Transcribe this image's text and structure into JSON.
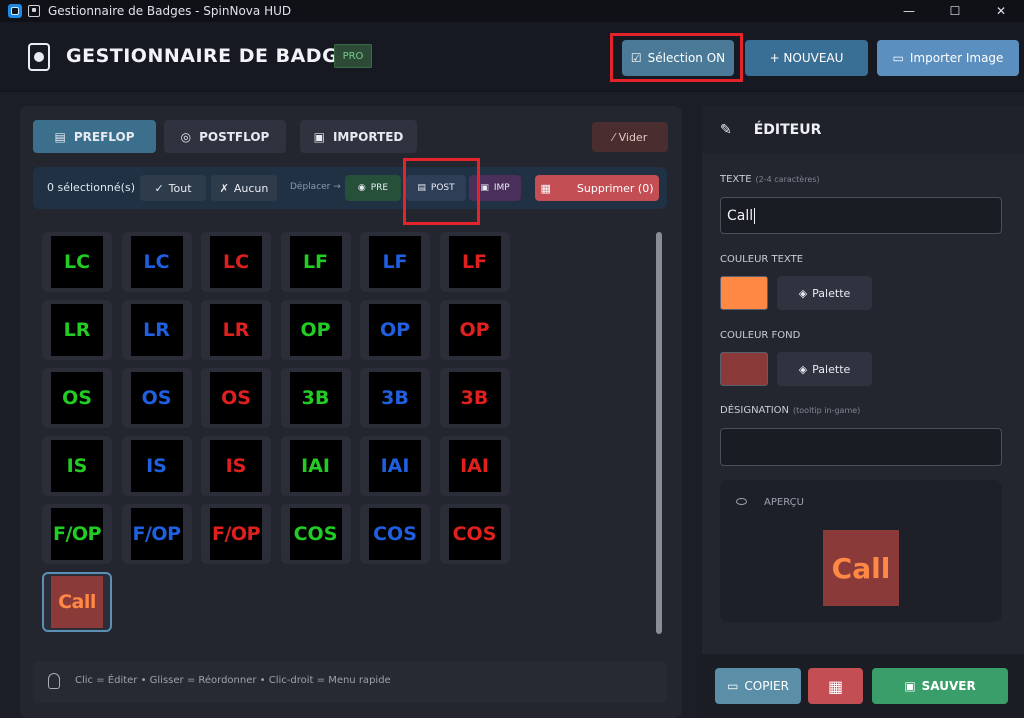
{
  "window": {
    "title": "Gestionnaire de Badges - SpinNova HUD",
    "minimize": "—",
    "maximize": "☐",
    "close": "✕"
  },
  "header": {
    "title": "GESTIONNAIRE DE BADGES",
    "badge": "PRO",
    "selection_label": "Sélection ON",
    "new_label": "+ NOUVEAU",
    "import_label": "Importer Image"
  },
  "tabs": [
    {
      "label": "PREFLOP",
      "active": true
    },
    {
      "label": "POSTFLOP",
      "active": false
    },
    {
      "label": "IMPORTED",
      "active": false
    }
  ],
  "clear_label": "Vider",
  "selection_bar": {
    "count": "0 sélectionné(s)",
    "all": "Tout",
    "none": "Aucun",
    "move_label": "Déplacer →",
    "pre": "PRE",
    "post": "POST",
    "imp": "IMP",
    "delete": "Supprimer (0)"
  },
  "badges": [
    {
      "text": "LC",
      "color": "#22cc22"
    },
    {
      "text": "LC",
      "color": "#1f5fe0"
    },
    {
      "text": "LC",
      "color": "#e01f1f"
    },
    {
      "text": "LF",
      "color": "#22cc22"
    },
    {
      "text": "LF",
      "color": "#1f5fe0"
    },
    {
      "text": "LF",
      "color": "#e01f1f"
    },
    {
      "text": "LR",
      "color": "#22cc22"
    },
    {
      "text": "LR",
      "color": "#1f5fe0"
    },
    {
      "text": "LR",
      "color": "#e01f1f"
    },
    {
      "text": "OP",
      "color": "#22cc22"
    },
    {
      "text": "OP",
      "color": "#1f5fe0"
    },
    {
      "text": "OP",
      "color": "#e01f1f"
    },
    {
      "text": "OS",
      "color": "#22cc22"
    },
    {
      "text": "OS",
      "color": "#1f5fe0"
    },
    {
      "text": "OS",
      "color": "#e01f1f"
    },
    {
      "text": "3B",
      "color": "#22cc22"
    },
    {
      "text": "3B",
      "color": "#1f5fe0"
    },
    {
      "text": "3B",
      "color": "#e01f1f"
    },
    {
      "text": "IS",
      "color": "#22cc22"
    },
    {
      "text": "IS",
      "color": "#1f5fe0"
    },
    {
      "text": "IS",
      "color": "#e01f1f"
    },
    {
      "text": "IAI",
      "color": "#22cc22"
    },
    {
      "text": "IAI",
      "color": "#1f5fe0"
    },
    {
      "text": "IAI",
      "color": "#e01f1f"
    },
    {
      "text": "F/OP",
      "color": "#22cc22"
    },
    {
      "text": "F/OP",
      "color": "#1f5fe0"
    },
    {
      "text": "F/OP",
      "color": "#e01f1f"
    },
    {
      "text": "COS",
      "color": "#22cc22"
    },
    {
      "text": "COS",
      "color": "#1f5fe0"
    },
    {
      "text": "COS",
      "color": "#e01f1f"
    },
    {
      "text": "Call",
      "color": "#ff8844",
      "bg": "#8b3a3a",
      "selected": true
    }
  ],
  "hint": "Clic = Éditer  •  Glisser = Réordonner  •  Clic-droit = Menu rapide",
  "editor": {
    "title": "ÉDITEUR",
    "text_label": "TEXTE",
    "text_hint": "(2-4 caractères)",
    "text_value": "Call",
    "text_color_label": "COULEUR TEXTE",
    "text_color": "#ff8844",
    "bg_color_label": "COULEUR FOND",
    "bg_color": "#8b3a3a",
    "palette_label": "Palette",
    "designation_label": "DÉSIGNATION",
    "designation_hint": "(tooltip in-game)",
    "designation_value": "",
    "preview_label": "APERÇU",
    "preview_text": "Call",
    "copy_label": "COPIER",
    "save_label": "SAUVER"
  }
}
